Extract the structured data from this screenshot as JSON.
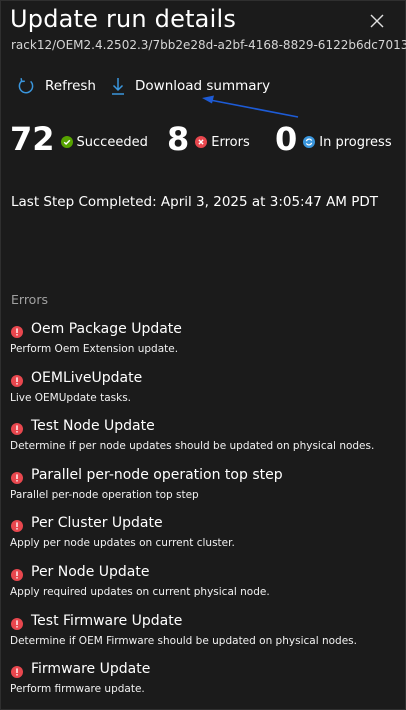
{
  "header": {
    "title": "Update run details",
    "subtitle": "rack12/OEM2.4.2502.3/7bb2e28d-a2bf-4168-8829-6122b6dc7013"
  },
  "toolbar": {
    "refresh_label": "Refresh",
    "download_label": "Download summary"
  },
  "stats": {
    "succeeded": {
      "count": "72",
      "label": "Succeeded",
      "icon": "check-circle-icon",
      "color": "#57a300"
    },
    "errors": {
      "count": "8",
      "label": "Errors",
      "icon": "error-circle-icon",
      "color": "#e8474e"
    },
    "in_progress": {
      "count": "0",
      "label": "In progress",
      "icon": "sync-circle-icon",
      "color": "#3a96dd"
    }
  },
  "last_step": "Last Step Completed: April 3, 2025 at 3:05:47 AM PDT",
  "errors_section": {
    "heading": "Errors",
    "items": [
      {
        "title": "Oem Package Update",
        "description": "Perform Oem Extension update."
      },
      {
        "title": "OEMLiveUpdate",
        "description": "Live OEMUpdate tasks."
      },
      {
        "title": "Test Node Update",
        "description": "Determine if per node updates should be updated on physical nodes."
      },
      {
        "title": "Parallel per-node operation top step",
        "description": "Parallel per-node operation top step"
      },
      {
        "title": "Per Cluster Update",
        "description": "Apply per node updates on current cluster."
      },
      {
        "title": "Per Node Update",
        "description": "Apply required updates on current physical node."
      },
      {
        "title": "Test Firmware Update",
        "description": "Determine if OEM Firmware should be updated on physical nodes."
      },
      {
        "title": "Firmware Update",
        "description": "Perform firmware update."
      }
    ]
  },
  "colors": {
    "background": "#1b1b1b",
    "accent": "#3a96dd",
    "error": "#e8474e",
    "success": "#57a300",
    "annotation_arrow": "#1d5bd6"
  }
}
